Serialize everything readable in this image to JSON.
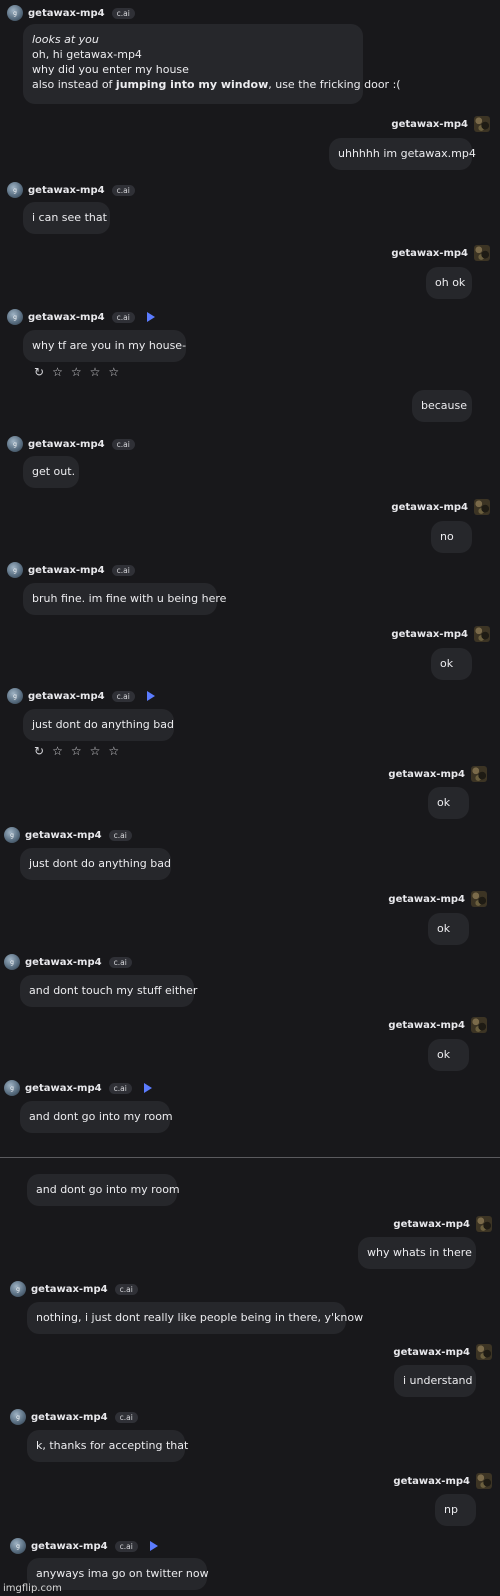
{
  "bot": {
    "name": "getawax-mp4",
    "badge": "c.ai",
    "initial": "g"
  },
  "user": {
    "name": "getawax-mp4"
  },
  "messages": {
    "m1": {
      "line1": "looks at you",
      "line2": "oh, hi getawax-mp4",
      "line3": "why did you enter my house",
      "line4_pre": "also instead of ",
      "line4_bold": "jumping into my window",
      "line4_post": ", use the fricking door :("
    },
    "m2": "uhhhhh im getawax.mp4",
    "m3": "i can see that",
    "m4": "oh ok",
    "m5": "why tf are you in my house-",
    "m6": "because",
    "m7": "get out.",
    "m8": "no",
    "m9": "bruh fine. im fine with u being here",
    "m10": "ok",
    "m11": "just dont do anything bad",
    "m12": "ok",
    "m13": "just dont do anything bad",
    "m14": "ok",
    "m15": "and dont touch my stuff either",
    "m16": "ok",
    "m17": "and dont go into my room",
    "m18": "and dont go into my room",
    "m19": "why whats in there",
    "m20": "nothing, i just dont really like people being in there, y'know",
    "m21": "i understand",
    "m22": "k, thanks for accepting that",
    "m23": "np",
    "m24": "anyways ima go on twitter now"
  },
  "icons": {
    "regenerate": "↻",
    "star": "☆"
  },
  "watermark": "imgflip.com"
}
